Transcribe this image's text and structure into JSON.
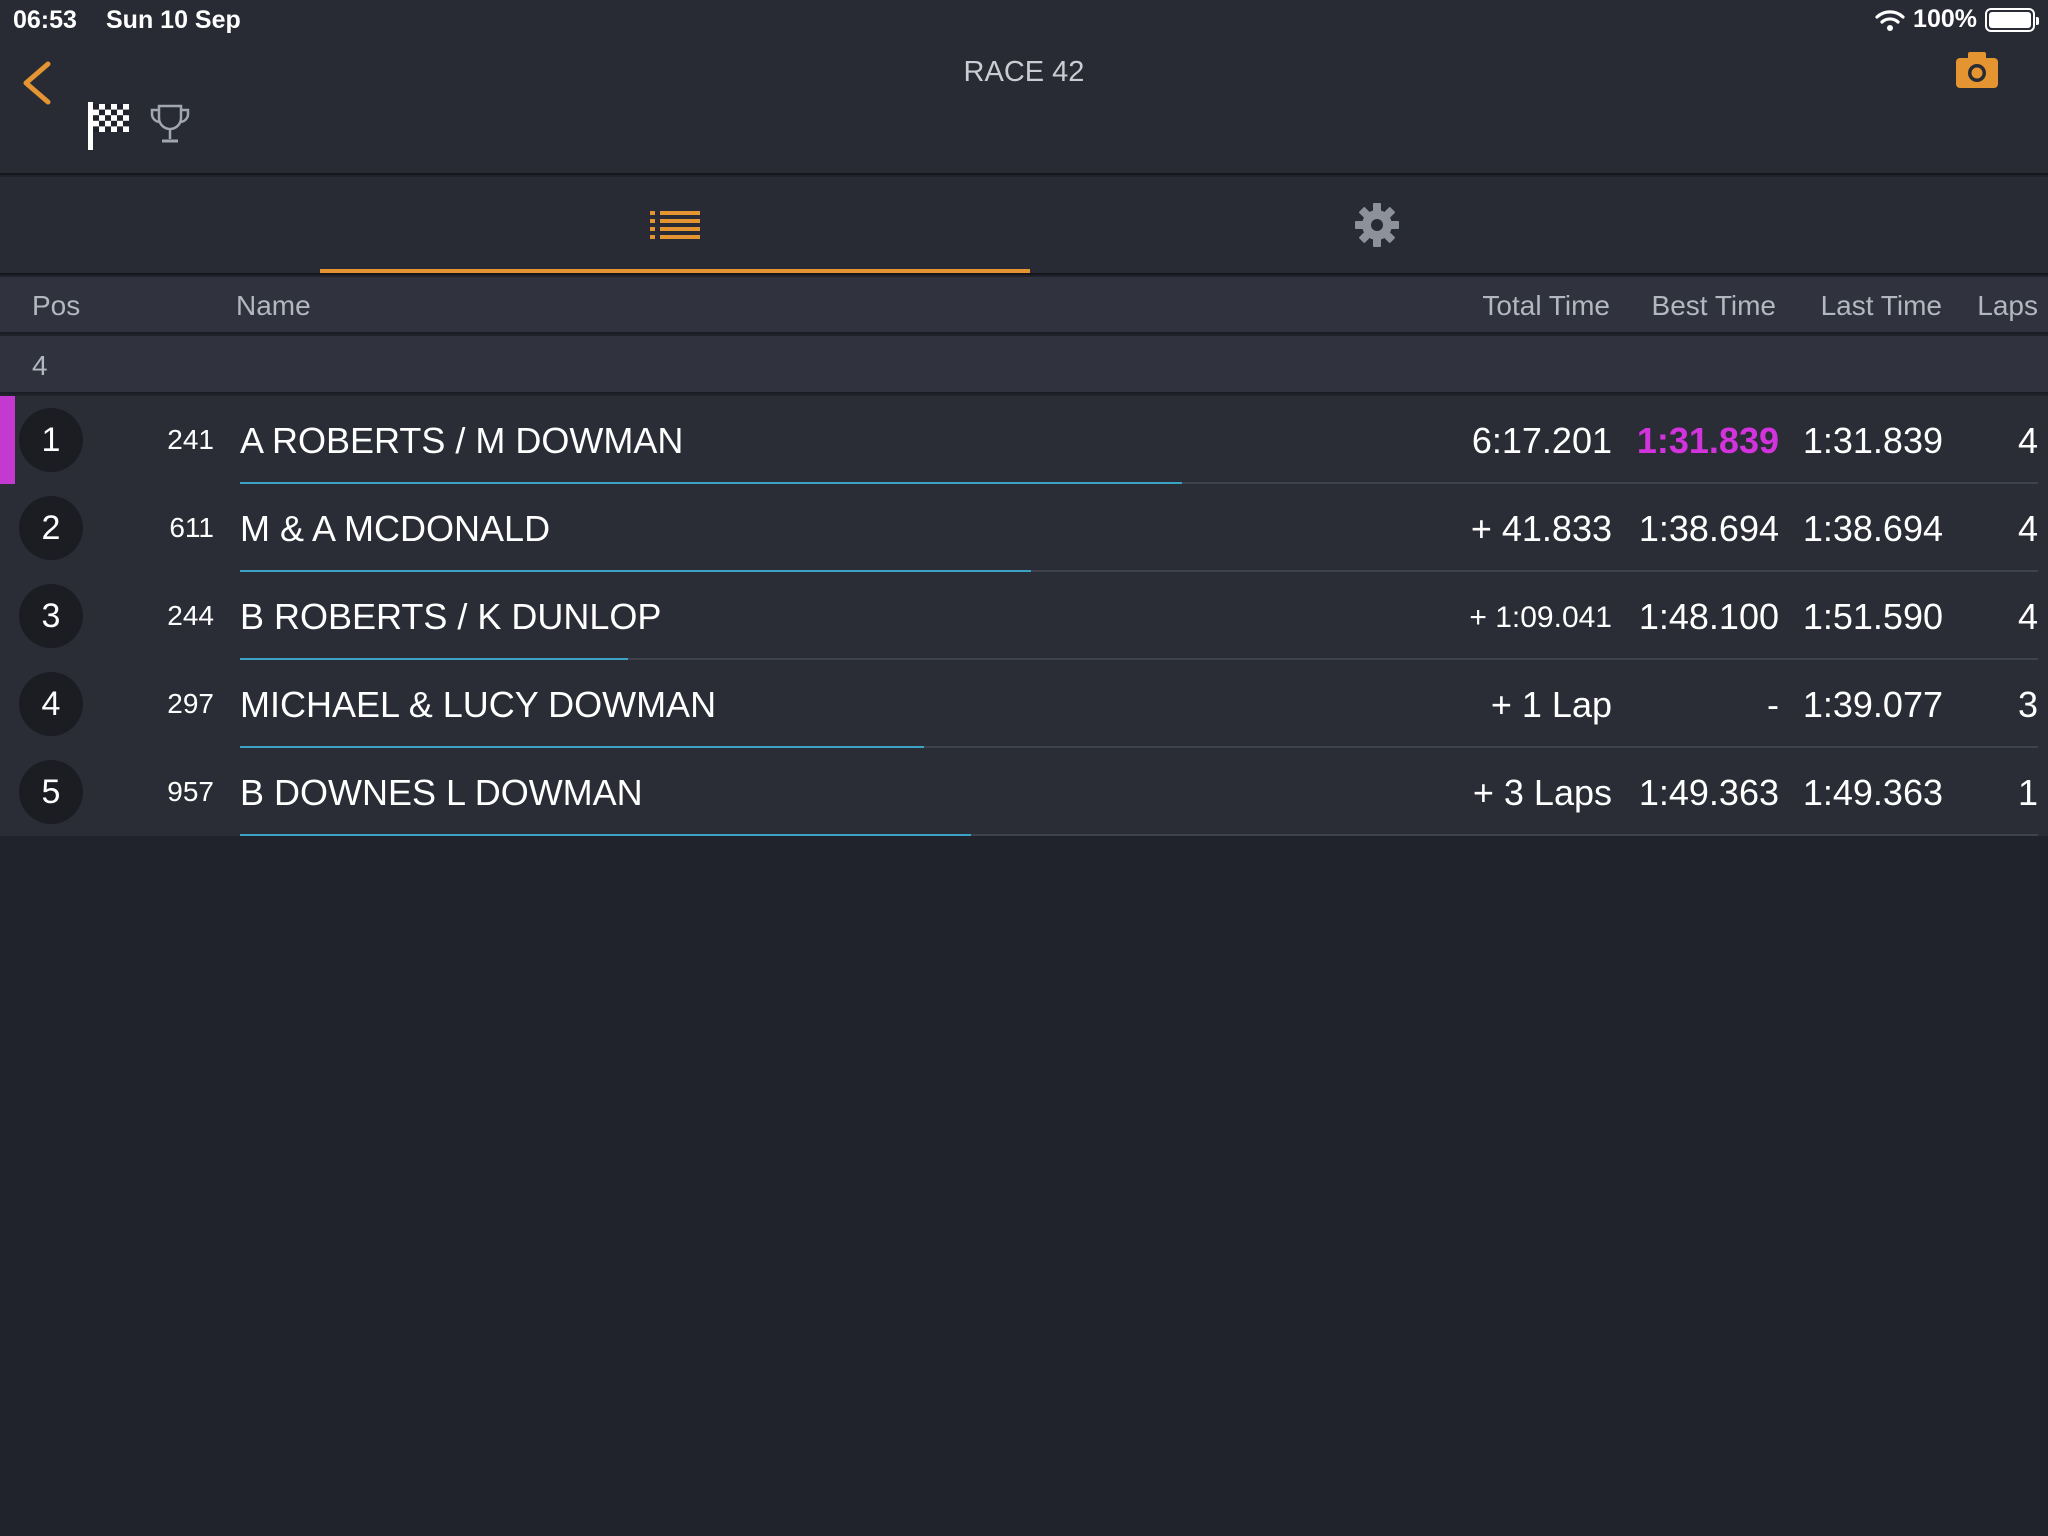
{
  "status": {
    "time": "06:53",
    "date": "Sun 10 Sep",
    "battery": "100%"
  },
  "header": {
    "title": "RACE 42",
    "accent_color": "#e59432"
  },
  "tabs": [
    {
      "name": "list-icon",
      "active": true
    },
    {
      "name": "gear-icon",
      "active": false
    }
  ],
  "columns": {
    "pos": "Pos",
    "name": "Name",
    "total": "Total Time",
    "best": "Best Time",
    "last": "Last Time",
    "laps": "Laps"
  },
  "group": {
    "label": "4"
  },
  "results": [
    {
      "pos": "1",
      "number": "241",
      "name": "A ROBERTS / M DOWMAN",
      "total": "6:17.201",
      "best": "1:31.839",
      "last": "1:31.839",
      "laps": "4"
    },
    {
      "pos": "2",
      "number": "611",
      "name": "M & A MCDONALD",
      "total": "+ 41.833",
      "best": "1:38.694",
      "last": "1:38.694",
      "laps": "4"
    },
    {
      "pos": "3",
      "number": "244",
      "name": "B ROBERTS / K DUNLOP",
      "total": "+ 1:09.041",
      "best": "1:48.100",
      "last": "1:51.590",
      "laps": "4"
    },
    {
      "pos": "4",
      "number": "297",
      "name": "MICHAEL & LUCY DOWMAN",
      "total": "+ 1 Lap",
      "best": "-",
      "last": "1:39.077",
      "laps": "3"
    },
    {
      "pos": "5",
      "number": "957",
      "name": "B DOWNES L DOWMAN",
      "total": "+ 3 Laps",
      "best": "1:49.363",
      "last": "1:49.363",
      "laps": "1"
    }
  ],
  "fastest_color": "#d233dc",
  "progress_color": "#3aa2c4"
}
